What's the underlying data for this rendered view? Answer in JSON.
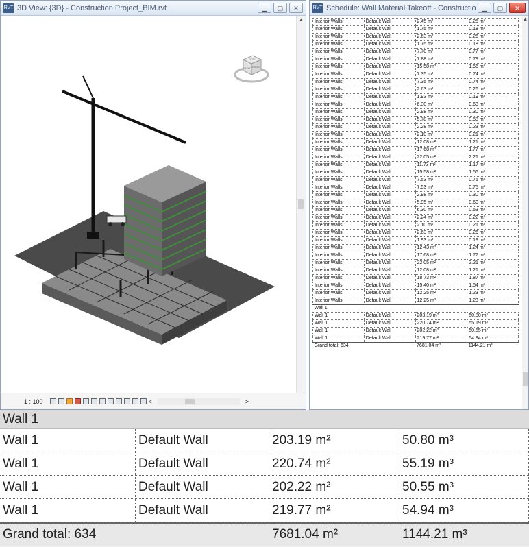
{
  "view3d": {
    "title": "3D View: {3D} - Construction Project_BIM.rvt",
    "scale": "1 : 100",
    "icons": [
      "detail-level-icon",
      "visual-style-icon",
      "sun-path-icon",
      "shadows-icon",
      "render-icon",
      "crop-icon",
      "show-crop-icon",
      "unlock-3d-view-icon",
      "temporary-hide-icon",
      "reveal-hidden-icon",
      "analytical-model-icon",
      "highlight-displacement-icon",
      "worksharing-icon"
    ],
    "viewcube": {
      "top": "TOP",
      "front": "FRONT",
      "right": "RIGHT"
    }
  },
  "schedule": {
    "title": "Schedule: Wall Material Takeoff - Construction Proj...",
    "rows": [
      [
        "Interior Walls",
        "Default Wall",
        "2.45 m²",
        "0.25 m³"
      ],
      [
        "Interior Walls",
        "Default Wall",
        "1.75 m²",
        "0.18 m³"
      ],
      [
        "Interior Walls",
        "Default Wall",
        "2.63 m²",
        "0.26 m³"
      ],
      [
        "Interior Walls",
        "Default Wall",
        "1.75 m²",
        "0.18 m³"
      ],
      [
        "Interior Walls",
        "Default Wall",
        "7.70 m²",
        "0.77 m³"
      ],
      [
        "Interior Walls",
        "Default Wall",
        "7.88 m²",
        "0.79 m³"
      ],
      [
        "Interior Walls",
        "Default Wall",
        "15.58 m²",
        "1.56 m³"
      ],
      [
        "Interior Walls",
        "Default Wall",
        "7.35 m²",
        "0.74 m³"
      ],
      [
        "Interior Walls",
        "Default Wall",
        "7.35 m²",
        "0.74 m³"
      ],
      [
        "Interior Walls",
        "Default Wall",
        "2.63 m²",
        "0.26 m³"
      ],
      [
        "Interior Walls",
        "Default Wall",
        "1.93 m²",
        "0.19 m³"
      ],
      [
        "Interior Walls",
        "Default Wall",
        "6.30 m²",
        "0.63 m³"
      ],
      [
        "Interior Walls",
        "Default Wall",
        "2.98 m²",
        "0.30 m³"
      ],
      [
        "Interior Walls",
        "Default Wall",
        "5.78 m²",
        "0.58 m³"
      ],
      [
        "Interior Walls",
        "Default Wall",
        "2.28 m²",
        "0.23 m³"
      ],
      [
        "Interior Walls",
        "Default Wall",
        "2.10 m²",
        "0.21 m³"
      ],
      [
        "Interior Walls",
        "Default Wall",
        "12.08 m²",
        "1.21 m³"
      ],
      [
        "Interior Walls",
        "Default Wall",
        "17.68 m²",
        "1.77 m³"
      ],
      [
        "Interior Walls",
        "Default Wall",
        "22.05 m²",
        "2.21 m³"
      ],
      [
        "Interior Walls",
        "Default Wall",
        "11.73 m²",
        "1.17 m³"
      ],
      [
        "Interior Walls",
        "Default Wall",
        "15.58 m²",
        "1.56 m³"
      ],
      [
        "Interior Walls",
        "Default Wall",
        "7.53 m²",
        "0.75 m³"
      ],
      [
        "Interior Walls",
        "Default Wall",
        "7.53 m²",
        "0.75 m³"
      ],
      [
        "Interior Walls",
        "Default Wall",
        "2.98 m²",
        "0.30 m³"
      ],
      [
        "Interior Walls",
        "Default Wall",
        "5.95 m²",
        "0.60 m³"
      ],
      [
        "Interior Walls",
        "Default Wall",
        "6.30 m²",
        "0.63 m³"
      ],
      [
        "Interior Walls",
        "Default Wall",
        "2.24 m²",
        "0.22 m³"
      ],
      [
        "Interior Walls",
        "Default Wall",
        "2.10 m²",
        "0.21 m³"
      ],
      [
        "Interior Walls",
        "Default Wall",
        "2.63 m²",
        "0.26 m³"
      ],
      [
        "Interior Walls",
        "Default Wall",
        "1.93 m²",
        "0.19 m³"
      ],
      [
        "Interior Walls",
        "Default Wall",
        "12.43 m²",
        "1.24 m³"
      ],
      [
        "Interior Walls",
        "Default Wall",
        "17.68 m²",
        "1.77 m³"
      ],
      [
        "Interior Walls",
        "Default Wall",
        "22.05 m²",
        "2.21 m³"
      ],
      [
        "Interior Walls",
        "Default Wall",
        "12.08 m²",
        "1.21 m³"
      ],
      [
        "Interior Walls",
        "Default Wall",
        "18.73 m²",
        "1.87 m³"
      ],
      [
        "Interior Walls",
        "Default Wall",
        "15.40 m²",
        "1.54 m³"
      ],
      [
        "Interior Walls",
        "Default Wall",
        "12.25 m²",
        "1.23 m³"
      ],
      [
        "Interior Walls",
        "Default Wall",
        "12.25 m²",
        "1.23 m³"
      ]
    ],
    "group_label": "Wall 1",
    "wall1_rows": [
      [
        "Wall 1",
        "Default Wall",
        "203.19 m²",
        "50.80 m³"
      ],
      [
        "Wall 1",
        "Default Wall",
        "220.74 m²",
        "55.19 m³"
      ],
      [
        "Wall 1",
        "Default Wall",
        "202.22 m²",
        "50.55 m³"
      ],
      [
        "Wall 1",
        "Default Wall",
        "219.77 m²",
        "54.94 m³"
      ]
    ],
    "total": {
      "label": "Grand total: 634",
      "area": "7681.04 m²",
      "volume": "1144.21 m³"
    }
  },
  "zoom": {
    "header": "Wall 1",
    "rows": [
      [
        "Wall 1",
        "Default Wall",
        "203.19 m²",
        "50.80 m³"
      ],
      [
        "Wall 1",
        "Default Wall",
        "220.74 m²",
        "55.19 m³"
      ],
      [
        "Wall 1",
        "Default Wall",
        "202.22 m²",
        "50.55 m³"
      ],
      [
        "Wall 1",
        "Default Wall",
        "219.77 m²",
        "54.94 m³"
      ]
    ],
    "total": {
      "label": "Grand total: 634",
      "area": "7681.04 m²",
      "volume": "1144.21 m³"
    }
  },
  "colors": {
    "window_border": "#8fa3bf",
    "close_red": "#c9362a",
    "model_green": "#3f8f3a",
    "ground": "#4a4a4a"
  }
}
